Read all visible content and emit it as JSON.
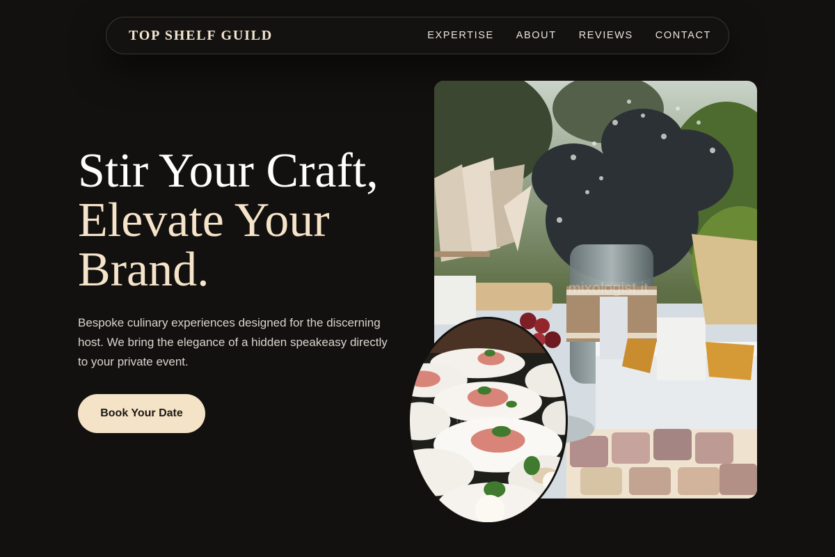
{
  "nav": {
    "brand": "TOP SHELF GUILD",
    "links": [
      "EXPERTISE",
      "ABOUT",
      "REVIEWS",
      "CONTACT"
    ]
  },
  "hero": {
    "title_line1": "Stir Your Craft,",
    "title_line2": "Elevate Your",
    "title_line3": "Brand.",
    "description": "Bespoke culinary experiences designed for the discerning host. We bring the elegance of a hidden speakeasy directly to your private event.",
    "cta_label": "Book Your Date"
  },
  "images": {
    "main_watermark": "mixologist.it",
    "oval_watermark": "mixologist.it"
  },
  "colors": {
    "background": "#13110f",
    "accent": "#f4e3c7",
    "heading": "#ffffff",
    "heading_accent": "#f5e4c9"
  }
}
